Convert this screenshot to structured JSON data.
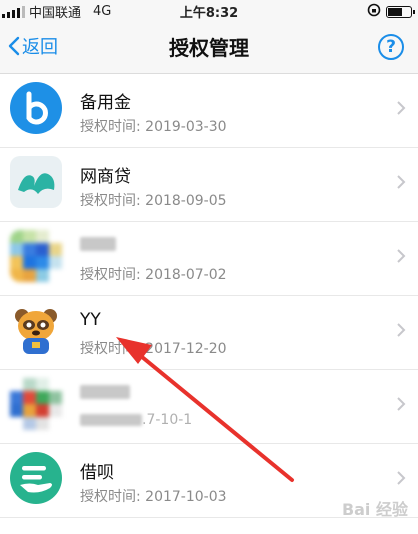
{
  "status_bar": {
    "carrier": "中国联通",
    "network": "4G",
    "time": "上午8:32"
  },
  "nav": {
    "back_label": "返回",
    "title": "授权管理",
    "help_symbol": "?"
  },
  "items": [
    {
      "name": "备用金",
      "time": "授权时间: 2019-03-30",
      "icon": "beiyongjin-logo-icon",
      "blurred": false
    },
    {
      "name": "网商贷",
      "time": "授权时间: 2018-09-05",
      "icon": "wangshangdai-logo-icon",
      "blurred": false
    },
    {
      "name": "",
      "time": "授权时间: 2018-07-02",
      "icon": "pixelated-app-icon",
      "blurred": true
    },
    {
      "name": "YY",
      "time": "授权时间: 2017-12-20",
      "icon": "yy-raccoon-logo-icon",
      "blurred": false
    },
    {
      "name": "",
      "time": ".7-10-1",
      "icon": "pixelated-app-icon",
      "blurred": true
    },
    {
      "name": "借呗",
      "time": "授权时间: 2017-10-03",
      "icon": "jiebei-logo-icon",
      "blurred": false
    }
  ],
  "watermark": "Bai 经验",
  "colors": {
    "accent": "#1a8de8",
    "annotation": "#e8322c"
  }
}
